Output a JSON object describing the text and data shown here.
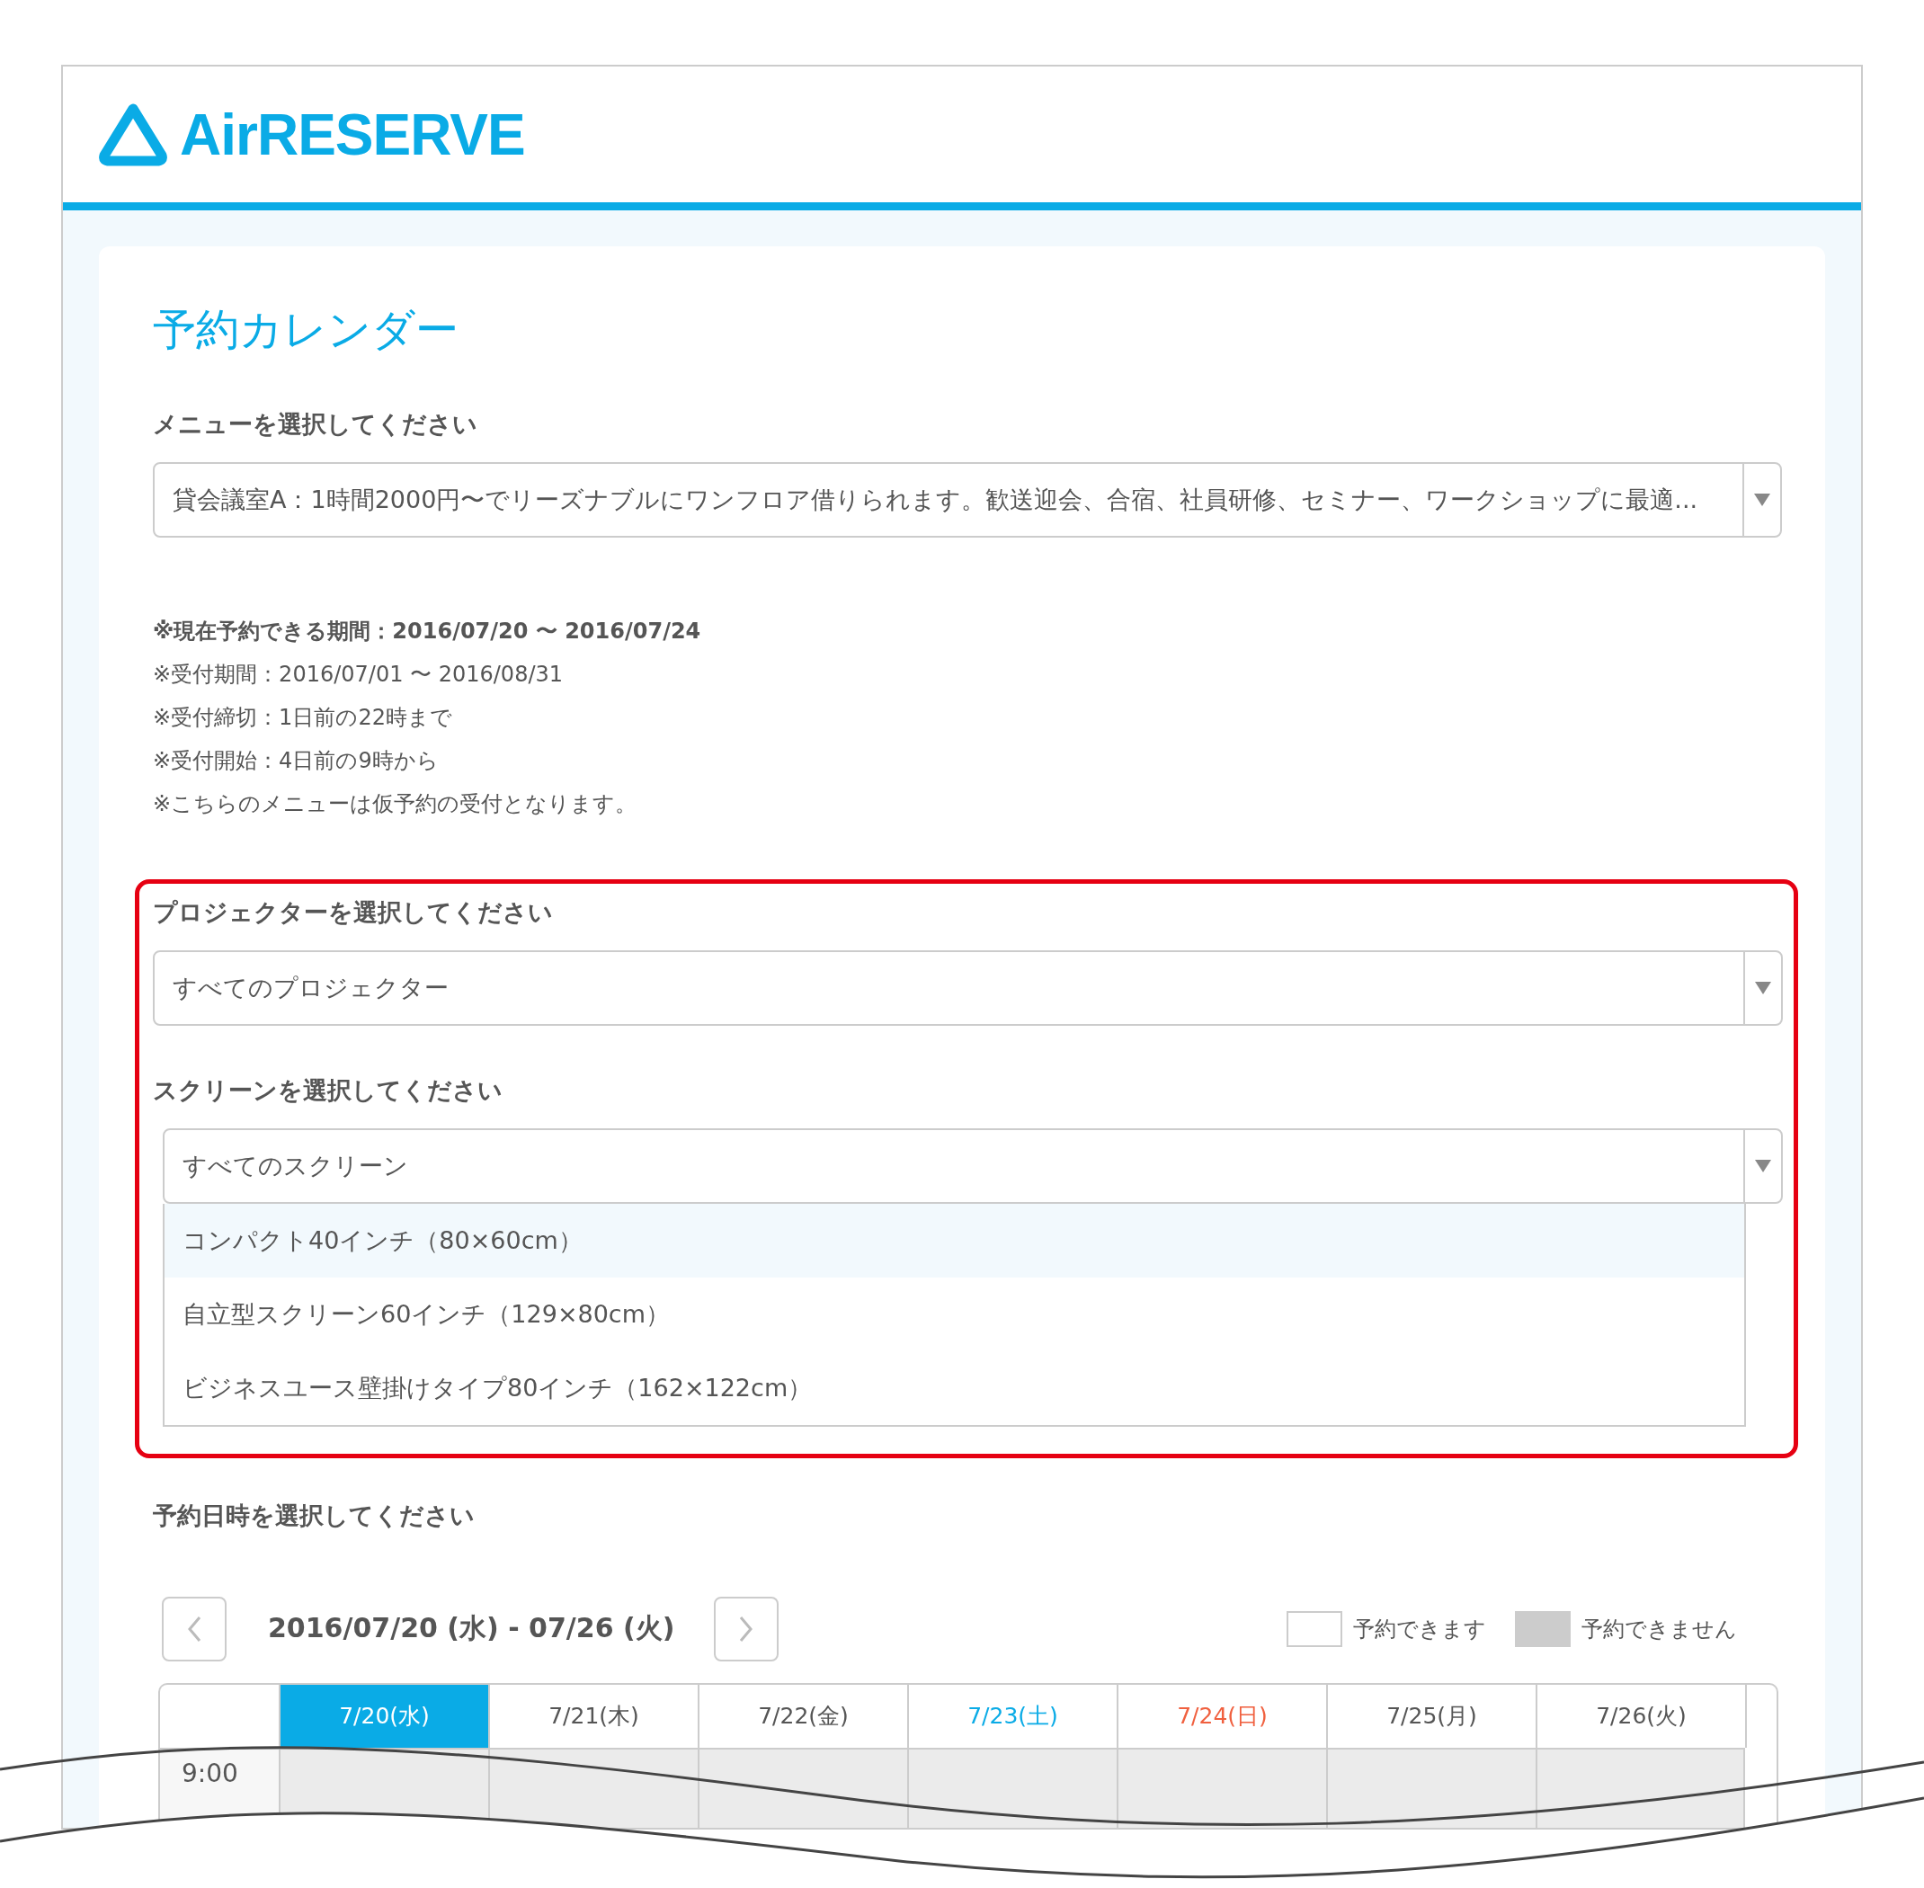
{
  "logo": {
    "text": "AirRESERVE"
  },
  "page_title": "予約カレンダー",
  "menu_select": {
    "label": "メニューを選択してください",
    "value": "貸会議室A：1時間2000円〜でリーズナブルにワンフロア借りられます。歓送迎会、合宿、社員研修、セミナー、ワークショップに最適..."
  },
  "notes": [
    {
      "text": "※現在予約できる期間：2016/07/20 〜 2016/07/24",
      "bold": true
    },
    {
      "text": "※受付期間：2016/07/01 〜 2016/08/31",
      "bold": false
    },
    {
      "text": "※受付締切：1日前の22時まで",
      "bold": false
    },
    {
      "text": "※受付開始：4日前の9時から",
      "bold": false
    },
    {
      "text": "※こちらのメニューは仮予約の受付となります。",
      "bold": false
    }
  ],
  "projector_select": {
    "label": "プロジェクターを選択してください",
    "value": "すべてのプロジェクター"
  },
  "screen_select": {
    "label": "スクリーンを選択してください",
    "value": "すべてのスクリーン",
    "expanded": true,
    "options": [
      {
        "label": "コンパクト40インチ（80×60cm）",
        "highlighted": true
      },
      {
        "label": "自立型スクリーン60インチ（129×80cm）",
        "highlighted": false
      },
      {
        "label": "ビジネスユース壁掛けタイプ80インチ（162×122cm）",
        "highlighted": false
      }
    ]
  },
  "datetime": {
    "label": "予約日時を選択してください",
    "range": "2016/07/20 (水) - 07/26 (火)",
    "legend": [
      {
        "label": "予約できます",
        "kind": "available"
      },
      {
        "label": "予約できません",
        "kind": "unavailable"
      }
    ]
  },
  "calendar": {
    "days": [
      {
        "label": "7/20(水)",
        "kind": "weekday",
        "selected": true
      },
      {
        "label": "7/21(木)",
        "kind": "weekday",
        "selected": false
      },
      {
        "label": "7/22(金)",
        "kind": "weekday",
        "selected": false
      },
      {
        "label": "7/23(土)",
        "kind": "saturday",
        "selected": false
      },
      {
        "label": "7/24(日)",
        "kind": "sunday",
        "selected": false
      },
      {
        "label": "7/25(月)",
        "kind": "weekday",
        "selected": false
      },
      {
        "label": "7/26(火)",
        "kind": "weekday",
        "selected": false
      }
    ],
    "rows": [
      {
        "time": "9:00"
      }
    ]
  }
}
